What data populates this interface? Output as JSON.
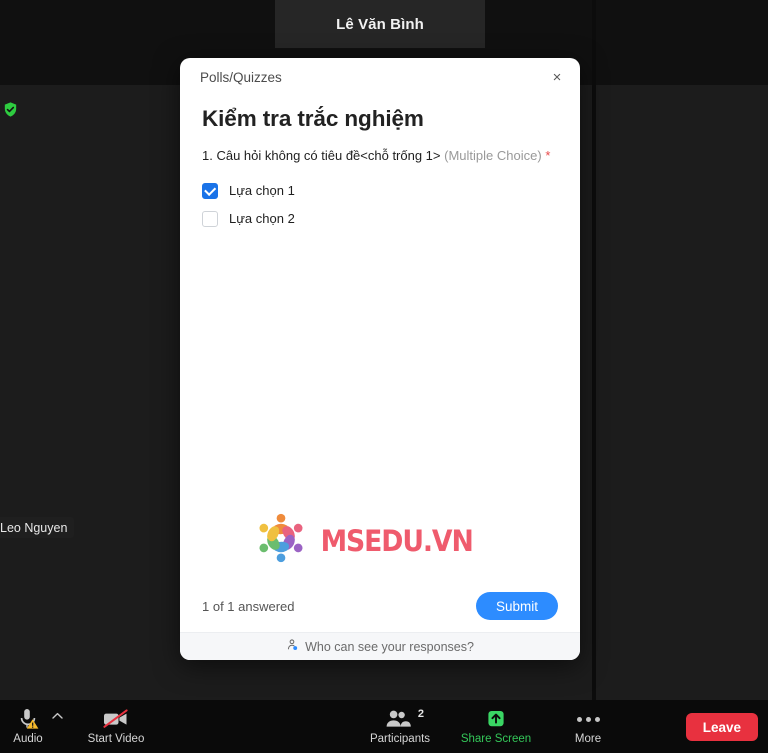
{
  "meeting": {
    "active_speaker_name": "Lê Văn Bình",
    "self_name_chip": "Leo Nguyen",
    "security_icon": "shield-check-icon"
  },
  "poll": {
    "window_title": "Polls/Quizzes",
    "close_label": "×",
    "heading": "Kiểm tra trắc nghiệm",
    "question": {
      "number_and_text": "1. Câu hỏi không có tiêu đề<chỗ trống 1>",
      "type_label": "(Multiple Choice)",
      "required_marker": "*"
    },
    "options": [
      {
        "label": "Lựa chọn 1",
        "checked": true
      },
      {
        "label": "Lựa chọn 2",
        "checked": false
      }
    ],
    "answered_status": "1 of 1 answered",
    "submit_label": "Submit",
    "privacy_label": "Who can see your responses?",
    "privacy_icon": "person-privacy-icon",
    "accent_color": "#2d8cff",
    "checkbox_color": "#1a73e8",
    "required_color": "#e8494a"
  },
  "watermark": {
    "text": "MSEDU.VN",
    "text_color": "#ef5b6d",
    "logo_icon": "people-circle-logo"
  },
  "toolbar": {
    "audio": {
      "label": "Audio",
      "icon": "microphone-warning-icon",
      "caret_icon": "chevron-up-icon"
    },
    "video": {
      "label": "Start Video",
      "icon": "camera-off-icon"
    },
    "participants": {
      "label": "Participants",
      "icon": "participants-icon",
      "count": "2"
    },
    "share": {
      "label": "Share Screen",
      "icon": "share-screen-up-arrow-icon",
      "color": "#34c759"
    },
    "more": {
      "label": "More",
      "icon": "ellipsis-icon"
    },
    "leave": {
      "label": "Leave",
      "color": "#e8313f"
    }
  }
}
